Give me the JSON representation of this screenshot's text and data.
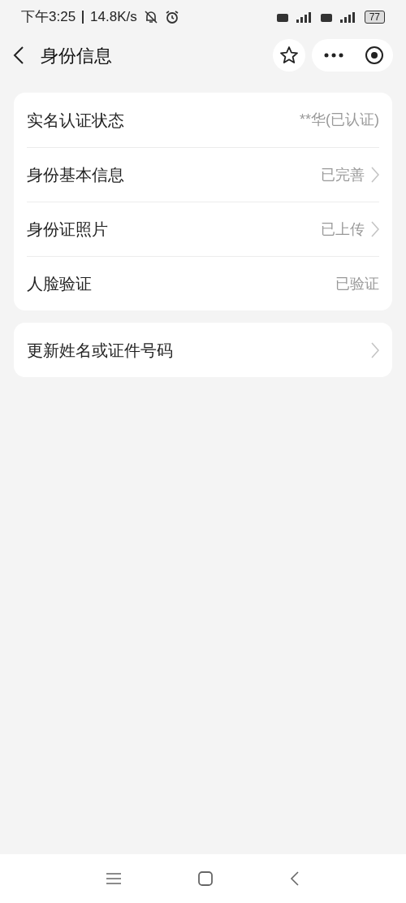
{
  "status_bar": {
    "time": "下午3:25",
    "speed": "14.8K/s",
    "battery": "77"
  },
  "nav": {
    "title": "身份信息"
  },
  "sections": [
    {
      "rows": [
        {
          "label": "实名认证状态",
          "value": "**华(已认证)",
          "has_arrow": false
        },
        {
          "label": "身份基本信息",
          "value": "已完善",
          "has_arrow": true
        },
        {
          "label": "身份证照片",
          "value": "已上传",
          "has_arrow": true
        },
        {
          "label": "人脸验证",
          "value": "已验证",
          "has_arrow": false
        }
      ]
    },
    {
      "rows": [
        {
          "label": "更新姓名或证件号码",
          "has_arrow": true
        }
      ]
    }
  ]
}
